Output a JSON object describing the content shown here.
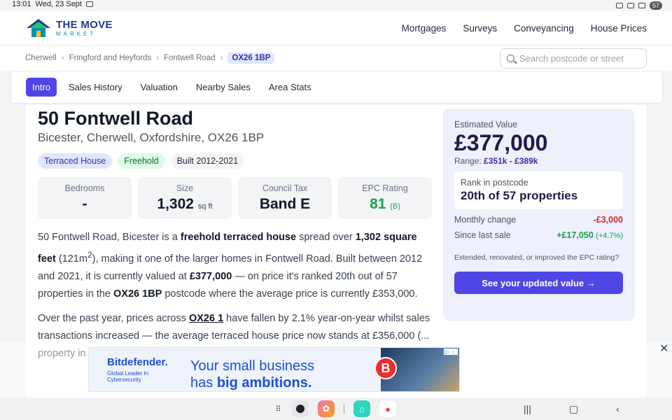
{
  "status": {
    "time": "13:01",
    "date": "Wed, 23 Sept",
    "battery": "57"
  },
  "header": {
    "logo_line1": "THE MOVE",
    "logo_line2": "MARKET",
    "nav": [
      "Mortgages",
      "Surveys",
      "Conveyancing",
      "House Prices"
    ]
  },
  "breadcrumb": [
    "Cherwell",
    "Fringford and Heyfords",
    "Fontwell Road"
  ],
  "breadcrumb_current": "OX26 1BP",
  "search": {
    "placeholder": "Search postcode or street"
  },
  "tabs": [
    "Intro",
    "Sales History",
    "Valuation",
    "Nearby Sales",
    "Area Stats"
  ],
  "property": {
    "title": "50 Fontwell Road",
    "subtitle": "Bicester, Cherwell, Oxfordshire, OX26 1BP",
    "badges": [
      "Terraced House",
      "Freehold",
      "Built 2012-2021"
    ],
    "stats": {
      "bedrooms_label": "Bedrooms",
      "bedrooms_value": "-",
      "size_label": "Size",
      "size_value": "1,302",
      "size_unit": "sq ft",
      "tax_label": "Council Tax",
      "tax_value": "Band E",
      "epc_label": "EPC Rating",
      "epc_value": "81",
      "epc_band": "(B)"
    }
  },
  "intro": {
    "p1_a": "50 Fontwell Road, Bicester is a ",
    "p1_b": "freehold terraced house",
    "p1_c": " spread over ",
    "p1_d": "1,302 square feet",
    "p1_e": " (121m",
    "p1_sup": "2",
    "p1_f": "), making it one of the larger homes in Fontwell Road. Built between 2012 and 2021, it is currently valued at ",
    "p1_g": "£377,000",
    "p1_h": " — on price it's ranked 20th out of 57 properties in the ",
    "p1_i": "OX26 1BP",
    "p1_j": " postcode where the average price is currently £353,000.",
    "p2_a": "Over the past year, prices across ",
    "p2_link": "OX26 1",
    "p2_b": " have fallen by 2.1% year-on-year whilst sales transactions increased — the average terraced house price now stands at £356,000 (... property in ..."
  },
  "estimate": {
    "label": "Estimated Value",
    "value": "£377,000",
    "range_label": "Range:",
    "range": "£351k - £389k",
    "rank_label": "Rank in postcode",
    "rank_value": "20th of 57 properties",
    "monthly_label": "Monthly change",
    "monthly_value": "-£3,000",
    "since_label": "Since last sale",
    "since_value": "+£17,050",
    "since_pct": "(+4.7%)",
    "note": "Extended, renovated, or improved the EPC rating?",
    "cta": "See your updated value →"
  },
  "ad": {
    "brand": "Bitdefender.",
    "brand_sub": "Global Leader In Cybersecurity",
    "headline_1": "Your small business",
    "headline_2a": "has ",
    "headline_2b": "big ambitions.",
    "logo_letter": "B",
    "close": "✕"
  },
  "colors": {
    "accent": "#4f46e5",
    "positive": "#16a34a",
    "negative": "#dc2626",
    "brand": "#1e3a8a"
  }
}
